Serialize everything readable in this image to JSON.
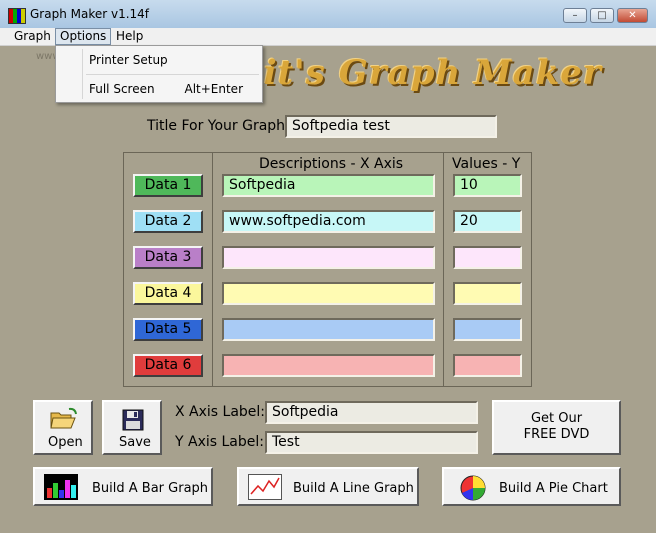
{
  "window": {
    "title": "Graph Maker v1.14f"
  },
  "menu": {
    "items": [
      "Graph",
      "Options",
      "Help"
    ],
    "dropdown": {
      "printer_setup": "Printer Setup",
      "full_screen": "Full Screen",
      "full_screen_shortcut": "Alt+Enter"
    }
  },
  "watermark": "www.softpe",
  "banner": "uit's Graph Maker",
  "title_field": {
    "label": "Title For Your Graph:",
    "value": "Softpedia test"
  },
  "table": {
    "header_desc": "Descriptions - X Axis",
    "header_values": "Values - Y",
    "rows": [
      {
        "label": "Data 1",
        "desc": "Softpedia",
        "value": "10",
        "btn_color": "#4fb85a",
        "field_color": "#b9f5b9"
      },
      {
        "label": "Data 2",
        "desc": "www.softpedia.com",
        "value": "20",
        "btn_color": "#9fdff5",
        "field_color": "#c7f7f7"
      },
      {
        "label": "Data 3",
        "desc": "",
        "value": "",
        "btn_color": "#b97fc8",
        "field_color": "#fde6fb"
      },
      {
        "label": "Data 4",
        "desc": "",
        "value": "",
        "btn_color": "#fbf79c",
        "field_color": "#fffbb3"
      },
      {
        "label": "Data 5",
        "desc": "",
        "value": "",
        "btn_color": "#2f67d6",
        "field_color": "#a9cbf5"
      },
      {
        "label": "Data 6",
        "desc": "",
        "value": "",
        "btn_color": "#e03c3c",
        "field_color": "#f7b3b3"
      }
    ]
  },
  "axis": {
    "x_label": "X Axis Label:",
    "x_value": "Softpedia",
    "y_label": "Y Axis Label:",
    "y_value": "Test"
  },
  "buttons": {
    "open": "Open",
    "save": "Save",
    "dvd_line1": "Get Our",
    "dvd_line2": "FREE DVD",
    "bar": "Build A Bar Graph",
    "line": "Build A Line Graph",
    "pie": "Build A Pie Chart"
  },
  "colors": {
    "background": "#a7a18e",
    "banner": "#d9a63a"
  }
}
